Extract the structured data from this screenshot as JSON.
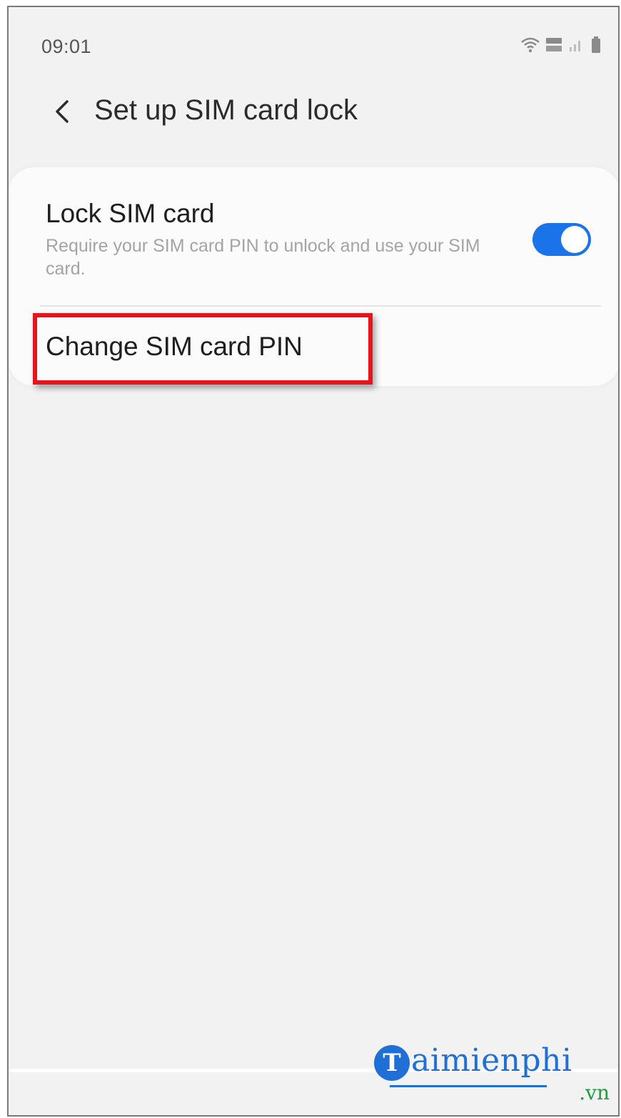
{
  "status_bar": {
    "time": "09:01",
    "icons": [
      "wifi-icon",
      "volte-lte-icon",
      "signal-icon",
      "battery-icon"
    ]
  },
  "header": {
    "back_icon": "chevron-left-icon",
    "title": "Set up SIM card lock"
  },
  "settings": {
    "lock_sim": {
      "title": "Lock SIM card",
      "description": "Require your SIM card PIN to unlock and use your SIM card.",
      "enabled": true
    },
    "change_pin": {
      "label": "Change SIM card PIN"
    }
  },
  "highlight": {
    "color": "#e8141b",
    "target": "Change SIM card PIN"
  },
  "watermark": {
    "badge_letter": "T",
    "word": "aimienphi",
    "tld": ".vn"
  },
  "colors": {
    "toggle_on": "#1a73e8",
    "background": "#f2f2f2",
    "card": "#fbfbfb",
    "watermark_blue": "#1f6fd6",
    "watermark_green": "#1f9e3a"
  }
}
